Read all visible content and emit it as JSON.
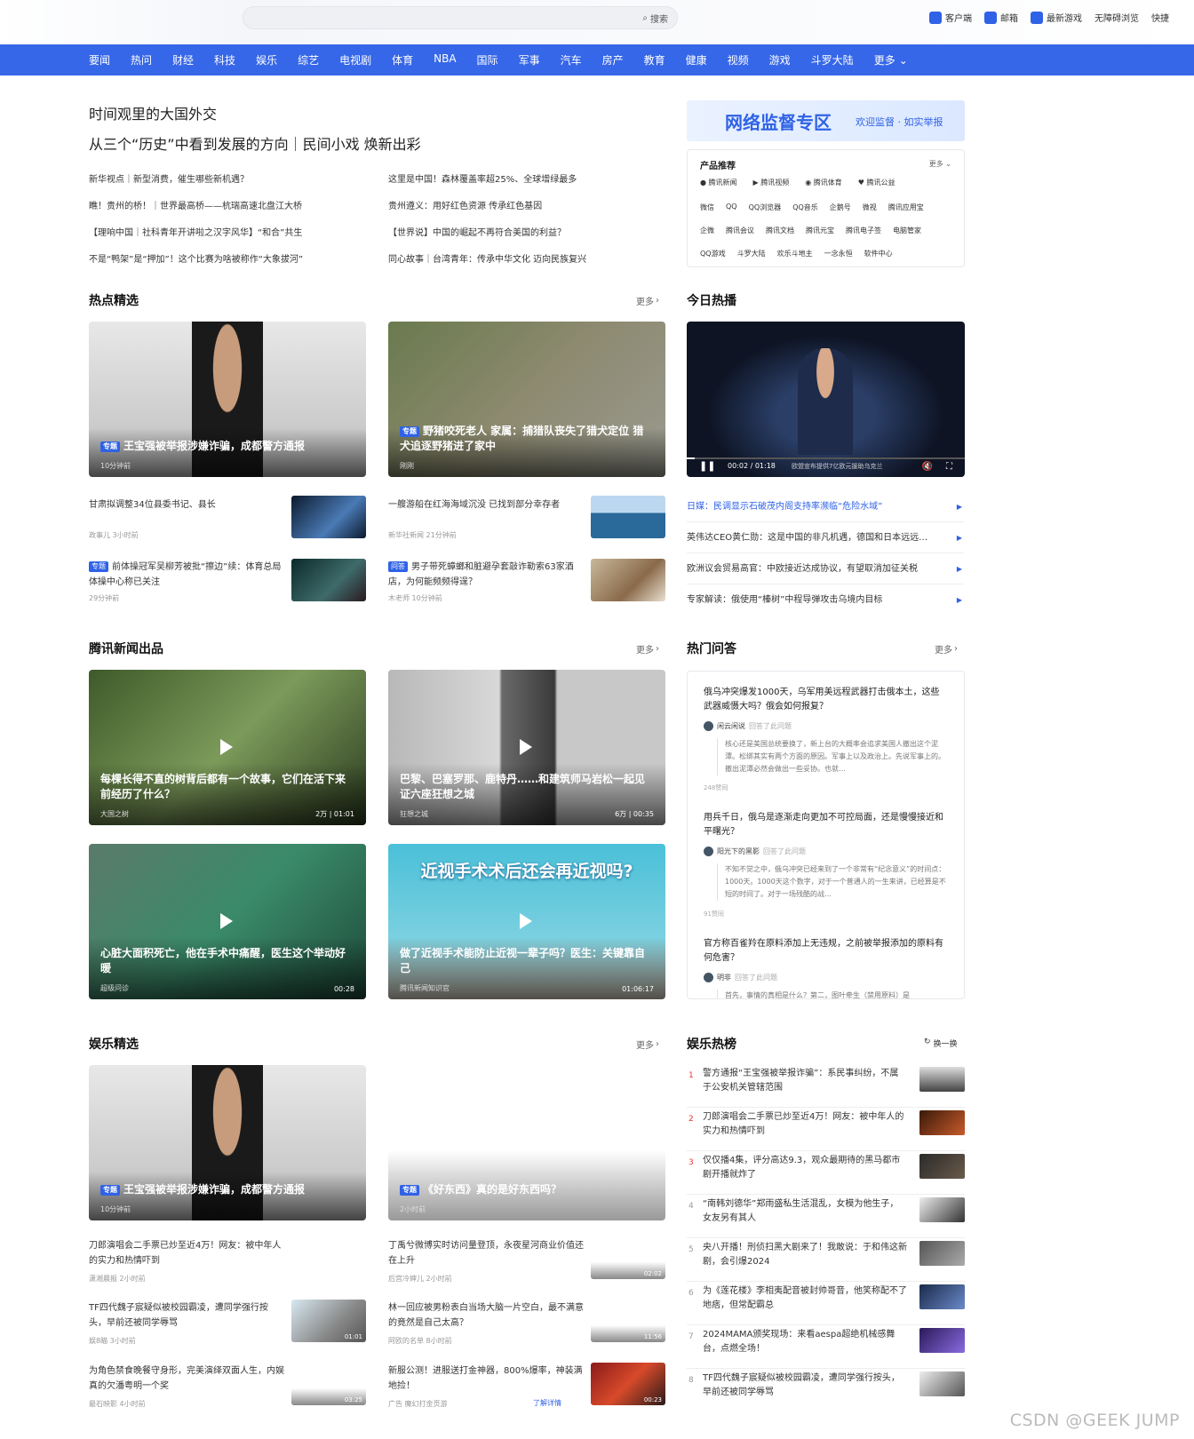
{
  "search": {
    "button": "搜索"
  },
  "toplinks": [
    "客户端",
    "邮箱",
    "最新游戏",
    "无障碍浏览",
    "快捷"
  ],
  "nav": [
    "要闻",
    "热问",
    "财经",
    "科技",
    "娱乐",
    "综艺",
    "电视剧",
    "体育",
    "NBA",
    "国际",
    "军事",
    "汽车",
    "房产",
    "教育",
    "健康",
    "视频",
    "游戏",
    "斗罗大陆"
  ],
  "nav_more": "更多",
  "headline": {
    "line1": "时间观里的大国外交",
    "line2": "从三个“历史”中看到发展的方向｜民间小戏 焕新出彩"
  },
  "news_left": [
    "新华视点｜新型消费，催生哪些新机遇？",
    "瞧！贵州的桥！｜世界最高桥——杭瑞高速北盘江大桥",
    "【理响中国｜社科青年开讲啦之汉字风华】“和合”共生",
    "不是“鸭架”是“押加”！这个比赛为啥被称作“大象拔河”"
  ],
  "news_right": [
    "这里是中国！森林覆盖率超25%、全球增绿最多",
    "贵州遵义：用好红色资源 传承红色基因",
    "【世界说】中国的崛起不再符合美国的利益？",
    "同心故事｜台湾青年：传承中华文化 迈向民族复兴"
  ],
  "banner": {
    "title": "网络监督专区",
    "sub": "欢迎监督 · 如实举报"
  },
  "products": {
    "title": "产品推荐",
    "more": "更多",
    "featured": [
      "腾讯新闻",
      "腾讯视频",
      "腾讯体育",
      "腾讯公益"
    ],
    "row1": [
      "微信",
      "QQ",
      "QQ浏览器",
      "QQ音乐",
      "企鹅号",
      "微视",
      "腾讯应用宝"
    ],
    "row2": [
      "企微",
      "腾讯会议",
      "腾讯文档",
      "腾讯元宝",
      "腾讯电子签",
      "电脑管家"
    ],
    "row3": [
      "QQ游戏",
      "斗罗大陆",
      "欢乐斗地主",
      "一念永恒",
      "软件中心"
    ]
  },
  "hot": {
    "title": "热点精选",
    "more": "更多",
    "card1": {
      "tag": "专题",
      "title": "王宝强被举报涉嫌诈骗，成都警方通报",
      "meta": "10分钟前"
    },
    "card2": {
      "tag": "专题",
      "title": "野猪咬死老人 家属：捕猎队丧失了猎犬定位 猎犬追逐野猪进了家中",
      "meta": "刚刚"
    },
    "items": [
      {
        "title": "甘肃拟调整34位县委书记、县长",
        "meta": "政事儿  3小时前"
      },
      {
        "title": "一艘游船在红海海域沉没 已找到部分幸存者",
        "meta": "新华社新闻  21分钟前"
      },
      {
        "tag": "专题",
        "title": "前体操冠军吴柳芳被批“擦边”续：体育总局体操中心称已关注",
        "meta": "29分钟前"
      },
      {
        "tag": "问答",
        "title": "男子带死蟑螂和脏避孕套敲诈勒索63家酒店，为何能频频得逞？",
        "meta": "木老师  10分钟前"
      }
    ]
  },
  "today": {
    "title": "今日热播",
    "video": {
      "time": "00:02",
      "total": "01:18",
      "ticker": "欧盟宣布提供7亿欧元援助乌克兰"
    },
    "items": [
      "日媒：民调显示石破茂内阁支持率濒临“危险水域”",
      "英伟达CEO黄仁勋：这是中国的非凡机遇，德国和日本远远…",
      "欧洲议会贸易高官：中欧接近达成协议，有望取消加征关税",
      "专家解读：俄使用“榛树”中程导弹攻击乌境内目标"
    ]
  },
  "tx": {
    "title": "腾讯新闻出品",
    "more": "更多",
    "cards": [
      {
        "title": "每棵长得不直的树背后都有一个故事，它们在活下来前经历了什么？",
        "meta": "大国之树",
        "dur": "2万 | 01:01"
      },
      {
        "title": "巴黎、巴塞罗那、鹿特丹……和建筑师马岩松一起见证六座狂想之城",
        "meta": "狂想之城",
        "dur": "6万 | 00:35"
      },
      {
        "title": "心脏大面积死亡，他在手术中痛醒，医生这个举动好暖",
        "meta": "超级问诊",
        "dur": "00:28"
      },
      {
        "title": "做了近视手术能防止近视一辈子吗？医生：关键靠自己",
        "meta": "腾讯新闻知识官",
        "dur": "01:06:17",
        "poster": "近视手术术后还会再近视吗?"
      }
    ]
  },
  "qa": {
    "title": "热门问答",
    "more": "更多",
    "items": [
      {
        "q": "俄乌冲突爆发1000天，乌军用美远程武器打击俄本土，这些武器威慑大吗？俄会如何报复？",
        "who": "闲云闲说",
        "act": "回答了此问题",
        "a": "核心还是美国总统要换了，新上台的大概率会追求美国人撤出这个泥潭。松绑其实有两个方面的原因。军事上以及政治上。先说军事上的。撤出泥潭必然会做出一些妥协。也就…",
        "zan": "248赞同"
      },
      {
        "q": "用兵千日，俄乌是逐渐走向更加不可控局面，还是慢慢接近和平曙光？",
        "who": "阳光下的黑影",
        "act": "回答了此问题",
        "a": "不知不觉之中，俄乌冲突已经来到了一个非常有“纪念意义”的时间点：1000天。1000天这个数字，对于一个普通人的一生来讲，已经算是不短的时间了。对于一场残酷的战…",
        "zan": "91赞同"
      },
      {
        "q": "官方称百雀羚在原料添加上无违规，之前被举报添加的原料有何危害？",
        "who": "明非",
        "act": "回答了此问题",
        "a": "首先，事情的真相是什么？第二，图叶牵生（禁用原料）是",
        "zan": ""
      }
    ]
  },
  "ent": {
    "title": "娱乐精选",
    "more": "更多",
    "card1": {
      "tag": "专题",
      "title": "王宝强被举报涉嫌诈骗，成都警方通报",
      "meta": "10分钟前"
    },
    "card2": {
      "tag": "专题",
      "title": "《好东西》真的是好东西吗？",
      "meta": "2小时前"
    },
    "items": [
      {
        "title": "刀郎演唱会二手票已炒至近4万！网友：被中年人的实力和热情吓到",
        "meta": "潇湘晨报  2小时前",
        "dur": ""
      },
      {
        "title": "丁禹兮微博实时访问量登顶，永夜星河商业价值还在上升",
        "meta": "后宫冷婶儿  2小时前",
        "dur": "02:02"
      },
      {
        "title": "TF四代魏子宸疑似被校园霸凌，遭同学强行按头，早前还被同学辱骂",
        "meta": "娱8瞄  3小时前",
        "dur": "01:01"
      },
      {
        "title": "林一回应被男粉表白当场大脑一片空白，最不满意的竟然是自己太高？",
        "meta": "阿欧的名单  8小时前",
        "dur": "11:56"
      },
      {
        "title": "为角色禁食晚餐守身形，完美演绎双面人生，内娱真的欠潘粤明一个奖",
        "meta": "最石映影  4小时前",
        "dur": "03:25"
      },
      {
        "title": "新服公测！进服送打金神器，800%爆率，神装满地捡！",
        "meta": "广告  魔幻打金页游",
        "dur": "00:23",
        "link": "了解详情"
      }
    ]
  },
  "rank": {
    "title": "娱乐热榜",
    "refresh": "换一换",
    "items": [
      "警方通报“王宝强被举报诈骗”：系民事纠纷，不属于公安机关管辖范围",
      "刀郎演唱会二手票已炒至近4万！网友：被中年人的实力和热情吓到",
      "仅仅播4集，评分高达9.3，观众最期待的黑马都市剧开播就炸了",
      "“南韩刘德华”郑雨盛私生活混乱，女模为他生子，女友另有其人",
      "央八开播！刑侦扫黑大剧来了！我敢说：于和伟这新剧，会引爆2024",
      "为《莲花楼》李相夷配音被封帅哥音，他笑称配不了地痞，但常配霸总",
      "2024MAMA颁奖现场：来看aespa超绝机械感舞台，点燃全场！",
      "TF四代魏子宸疑似被校园霸凌，遭同学强行按头，早前还被同学辱骂"
    ]
  },
  "watermark": "CSDN @GEEK JUMP"
}
